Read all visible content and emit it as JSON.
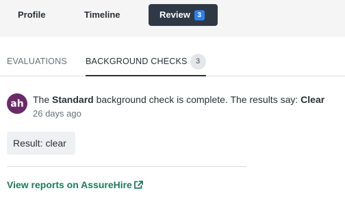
{
  "top_tabs": [
    {
      "label": "Profile"
    },
    {
      "label": "Timeline"
    },
    {
      "label": "Review",
      "badge": "3",
      "active": true
    }
  ],
  "sub_tabs": [
    {
      "label": "EVALUATIONS"
    },
    {
      "label": "BACKGROUND CHECKS",
      "count": "3",
      "active": true
    }
  ],
  "check": {
    "avatar_text": "ah",
    "prefix": "The ",
    "package": "Standard",
    "middle": " background check is complete. The results say: ",
    "result": "Clear",
    "timestamp": "26 days ago"
  },
  "result_label": "Result: clear",
  "report_link": "View reports on AssureHire",
  "colors": {
    "active_tab_bg": "#2f3945",
    "badge_blue": "#2f80ed",
    "avatar_purple": "#6a2a68",
    "link_green": "#1c7a5a"
  },
  "icons": {
    "avatar": "assurehire-logo",
    "link": "external-link-icon"
  }
}
